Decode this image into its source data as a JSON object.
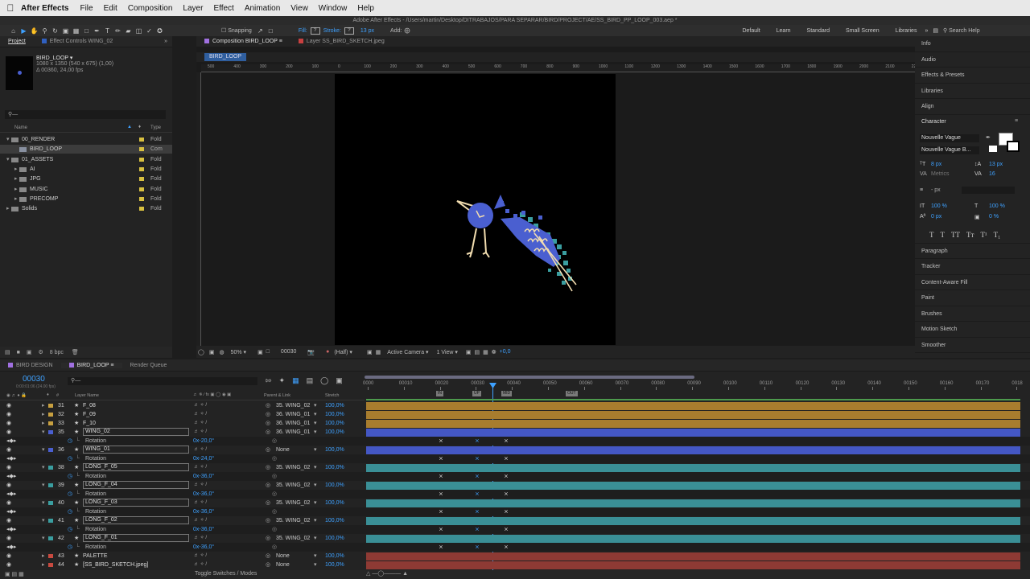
{
  "menubar": {
    "app": "After Effects",
    "items": [
      "File",
      "Edit",
      "Composition",
      "Layer",
      "Effect",
      "Animation",
      "View",
      "Window",
      "Help"
    ]
  },
  "title": "Adobe After Effects - /Users/martin/Desktop/DITRABAJOS/PARA SEPARAR/BIRD/PROJECT/AE/SS_BIRD_PP_LOOP_003.aep *",
  "toolbar": {
    "snapping": "Snapping",
    "fill_label": "Fill:",
    "stroke_label": "Stroke:",
    "stroke_px": "13 px",
    "add_label": "Add:",
    "workspaces": [
      "Default",
      "Learn",
      "Standard",
      "Small Screen",
      "Libraries"
    ],
    "search_placeholder": "Search Help"
  },
  "project": {
    "tabs": [
      "Project",
      "Effect Controls WING_02"
    ],
    "item_name": "BIRD_LOOP ▾",
    "item_info1": "1080 x 1350  (540 x 675) (1,00)",
    "item_info2": "Δ 00360, 24,00 fps",
    "col_name": "Name",
    "col_type": "Type",
    "items": [
      {
        "name": "00_RENDER",
        "type": "Fold",
        "indent": 0,
        "tri": "▾",
        "sel": false
      },
      {
        "name": "BIRD_LOOP",
        "type": "Com",
        "indent": 1,
        "tri": "",
        "sel": true
      },
      {
        "name": "01_ASSETS",
        "type": "Fold",
        "indent": 0,
        "tri": "▾",
        "sel": false
      },
      {
        "name": "AI",
        "type": "Fold",
        "indent": 1,
        "tri": "▸",
        "sel": false
      },
      {
        "name": "JPG",
        "type": "Fold",
        "indent": 1,
        "tri": "▸",
        "sel": false
      },
      {
        "name": "MUSIC",
        "type": "Fold",
        "indent": 1,
        "tri": "▸",
        "sel": false
      },
      {
        "name": "PRECOMP",
        "type": "Fold",
        "indent": 1,
        "tri": "▸",
        "sel": false
      },
      {
        "name": "Solids",
        "type": "Fold",
        "indent": 0,
        "tri": "▸",
        "sel": false
      }
    ],
    "bpc": "8 bpc"
  },
  "viewer": {
    "tabs": [
      "Composition BIRD_LOOP",
      "Layer SS_BIRD_SKETCH.jpeg"
    ],
    "crumb": "BIRD_LOOP",
    "zoom": "50%",
    "timecode": "00030",
    "resolution": "(Half)",
    "camera": "Active Camera",
    "views": "1 View",
    "exposure": "+0,0",
    "ruler_labels": [
      "500",
      "400",
      "300",
      "200",
      "100",
      "0",
      "100",
      "200",
      "300",
      "400",
      "500",
      "600",
      "700",
      "800",
      "900",
      "1000",
      "1100",
      "1200",
      "1300",
      "1400",
      "1500",
      "1600",
      "1700",
      "1800",
      "1900",
      "2000",
      "2100",
      "2200"
    ]
  },
  "right_panel": {
    "items_top": [
      "Info",
      "Audio",
      "Effects & Presets",
      "Libraries",
      "Align"
    ],
    "character": {
      "title": "Character",
      "font": "Nouvelle Vague",
      "style": "Nouvelle Vague B...",
      "size": "8 px",
      "leading": "13 px",
      "kerning": "Metrics",
      "tracking": "16",
      "stroke": "- px",
      "vscale": "100 %",
      "hscale": "100 %",
      "baseline": "0 px",
      "tsume": "0 %",
      "styles": [
        "T",
        "T",
        "TT",
        "Tт",
        "T¹",
        "T₁"
      ]
    },
    "items_bottom": [
      "Paragraph",
      "Tracker",
      "Content-Aware Fill",
      "Paint",
      "Brushes",
      "Motion Sketch",
      "Smoother"
    ]
  },
  "timeline": {
    "tabs": [
      "BIRD DESIGN",
      "BIRD_LOOP",
      "Render Queue"
    ],
    "timecode": "00030",
    "timecode_sub": "0:00:01:06 (24.00 fps)",
    "col_layer": "Layer Name",
    "col_parent": "Parent & Link",
    "col_stretch": "Stretch",
    "ruler": [
      "0000",
      "00010",
      "00020",
      "00030",
      "00040",
      "00050",
      "00060",
      "00070",
      "00080",
      "00090",
      "00100",
      "00110",
      "00120",
      "00130",
      "00140",
      "00150",
      "00160",
      "00170",
      "0018"
    ],
    "markers": [
      "IN",
      "UP",
      "MID",
      "OUT"
    ],
    "rows": [
      {
        "type": "layer",
        "num": "31",
        "name": "F_08",
        "parent": "35. WING_02",
        "stretch": "100,0%",
        "color": "#c8a040",
        "bar": "#a87d2e"
      },
      {
        "type": "layer",
        "num": "32",
        "name": "F_09",
        "parent": "36. WING_01",
        "stretch": "100,0%",
        "color": "#c8a040",
        "bar": "#a87d2e"
      },
      {
        "type": "layer",
        "num": "33",
        "name": "F_10",
        "parent": "36. WING_01",
        "stretch": "100,0%",
        "color": "#c8a040",
        "bar": "#a87d2e"
      },
      {
        "type": "layer",
        "num": "35",
        "name": "WING_02",
        "parent": "36. WING_01",
        "stretch": "100,0%",
        "color": "#4a5fd0",
        "bar": "#4457c4",
        "boxed": true
      },
      {
        "type": "prop",
        "name": "Rotation",
        "value": "0x-20,0°"
      },
      {
        "type": "layer",
        "num": "36",
        "name": "WING_01",
        "parent": "None",
        "stretch": "100,0%",
        "color": "#4a5fd0",
        "bar": "#4457c4",
        "boxed": true
      },
      {
        "type": "prop",
        "name": "Rotation",
        "value": "0x-24,0°"
      },
      {
        "type": "layer",
        "num": "38",
        "name": "LONG_F_05",
        "parent": "35. WING_02",
        "stretch": "100,0%",
        "color": "#3a9ea0",
        "bar": "#3a8f96",
        "boxed": true
      },
      {
        "type": "prop",
        "name": "Rotation",
        "value": "0x-36,0°"
      },
      {
        "type": "layer",
        "num": "39",
        "name": "LONG_F_04",
        "parent": "35. WING_02",
        "stretch": "100,0%",
        "color": "#3a9ea0",
        "bar": "#3a8f96",
        "boxed": true
      },
      {
        "type": "prop",
        "name": "Rotation",
        "value": "0x-36,0°"
      },
      {
        "type": "layer",
        "num": "40",
        "name": "LONG_F_03",
        "parent": "35. WING_02",
        "stretch": "100,0%",
        "color": "#3a9ea0",
        "bar": "#3a8f96",
        "boxed": true
      },
      {
        "type": "prop",
        "name": "Rotation",
        "value": "0x-36,0°"
      },
      {
        "type": "layer",
        "num": "41",
        "name": "LONG_F_02",
        "parent": "35. WING_02",
        "stretch": "100,0%",
        "color": "#3a9ea0",
        "bar": "#3a8f96",
        "boxed": true
      },
      {
        "type": "prop",
        "name": "Rotation",
        "value": "0x-36,0°"
      },
      {
        "type": "layer",
        "num": "42",
        "name": "LONG_F_01",
        "parent": "35. WING_02",
        "stretch": "100,0%",
        "color": "#3a9ea0",
        "bar": "#3a8f96",
        "boxed": true
      },
      {
        "type": "prop",
        "name": "Rotation",
        "value": "0x-36,0°"
      },
      {
        "type": "layer",
        "num": "43",
        "name": "PALETTE",
        "parent": "None",
        "stretch": "100,0%",
        "color": "#c84a40",
        "bar": "#8e3a34"
      },
      {
        "type": "layer",
        "num": "44",
        "name": "[SS_BIRD_SKETCH.jpeg]",
        "parent": "None",
        "stretch": "100,0%",
        "color": "#c84a40",
        "bar": "#8e3a34"
      }
    ],
    "footer": "Toggle Switches / Modes"
  },
  "colors": {
    "accent": "#3ea1ff",
    "bird_blue": "#4a5fd0",
    "teal": "#3a9ea0",
    "orange": "#a87d2e",
    "red": "#8e3a34"
  }
}
